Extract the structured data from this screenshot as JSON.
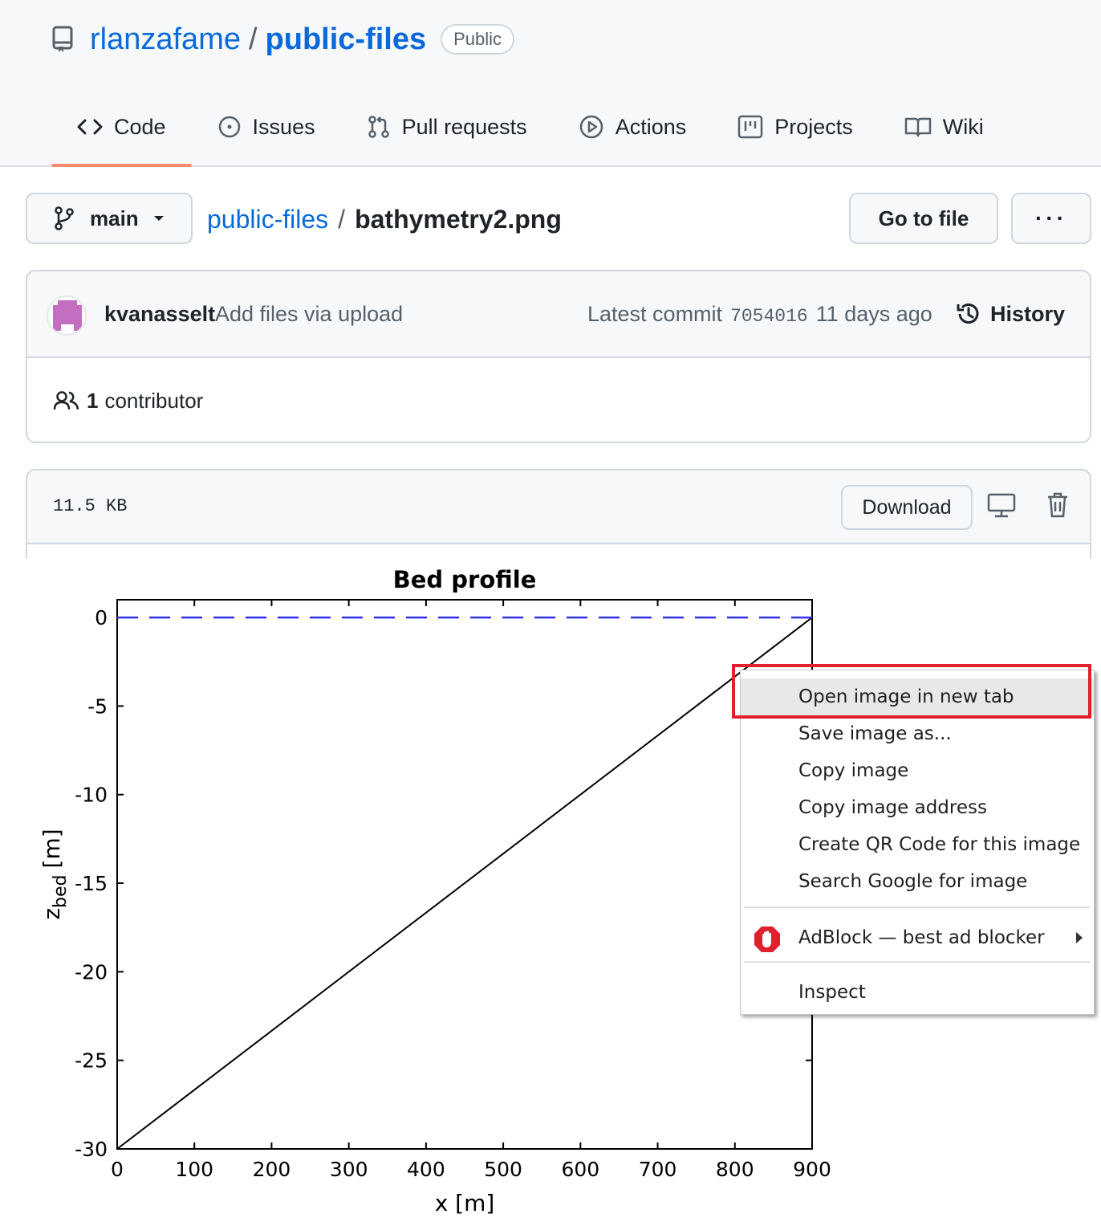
{
  "repo": {
    "owner": "rlanzafame",
    "separator": "/",
    "name": "public-files",
    "visibility": "Public"
  },
  "tabs": [
    {
      "label": "Code",
      "icon": "code-icon",
      "active": true
    },
    {
      "label": "Issues",
      "icon": "issue-icon"
    },
    {
      "label": "Pull requests",
      "icon": "pull-request-icon"
    },
    {
      "label": "Actions",
      "icon": "play-icon"
    },
    {
      "label": "Projects",
      "icon": "project-icon"
    },
    {
      "label": "Wiki",
      "icon": "book-icon"
    }
  ],
  "pathbar": {
    "branch": "main",
    "crumb_repo": "public-files",
    "crumb_sep": "/",
    "crumb_file": "bathymetry2.png",
    "goto_label": "Go to file",
    "more_label": "···"
  },
  "commit": {
    "author": "kvanasselt",
    "message": "Add files via upload",
    "latest_prefix": "Latest commit",
    "sha": "7054016",
    "age": "11 days ago",
    "history_label": "History",
    "contributors_count": "1",
    "contributors_label": "contributor"
  },
  "file": {
    "size": "11.5 KB",
    "download_label": "Download"
  },
  "chart_data": {
    "type": "line",
    "title": "Bed profile",
    "xlabel": "x [m]",
    "ylabel_main": "z",
    "ylabel_sub": "bed",
    "ylabel_unit": "[m]",
    "xlim": [
      0,
      900
    ],
    "ylim": [
      -30,
      1
    ],
    "xticks": [
      0,
      100,
      200,
      300,
      400,
      500,
      600,
      700,
      800,
      900
    ],
    "yticks": [
      0,
      -5,
      -10,
      -15,
      -20,
      -25,
      -30
    ],
    "series": [
      {
        "style": "solid",
        "color": "#000000",
        "x": [
          0,
          900
        ],
        "y": [
          -30,
          0
        ]
      },
      {
        "style": "dashed",
        "color": "#3333ee",
        "x": [
          0,
          900
        ],
        "y": [
          0,
          0
        ]
      }
    ]
  },
  "context_menu": {
    "items": [
      {
        "label": "Open image in new tab",
        "highlighted": true
      },
      {
        "label": "Save image as..."
      },
      {
        "label": "Copy image"
      },
      {
        "label": "Copy image address"
      },
      {
        "label": "Create QR Code for this image"
      },
      {
        "label": "Search Google for image"
      },
      {
        "label": "AdBlock — best ad blocker",
        "icon": "adblock-icon",
        "submenu": true
      },
      {
        "label": "Inspect"
      }
    ],
    "highlight_color": "#e0202c"
  }
}
